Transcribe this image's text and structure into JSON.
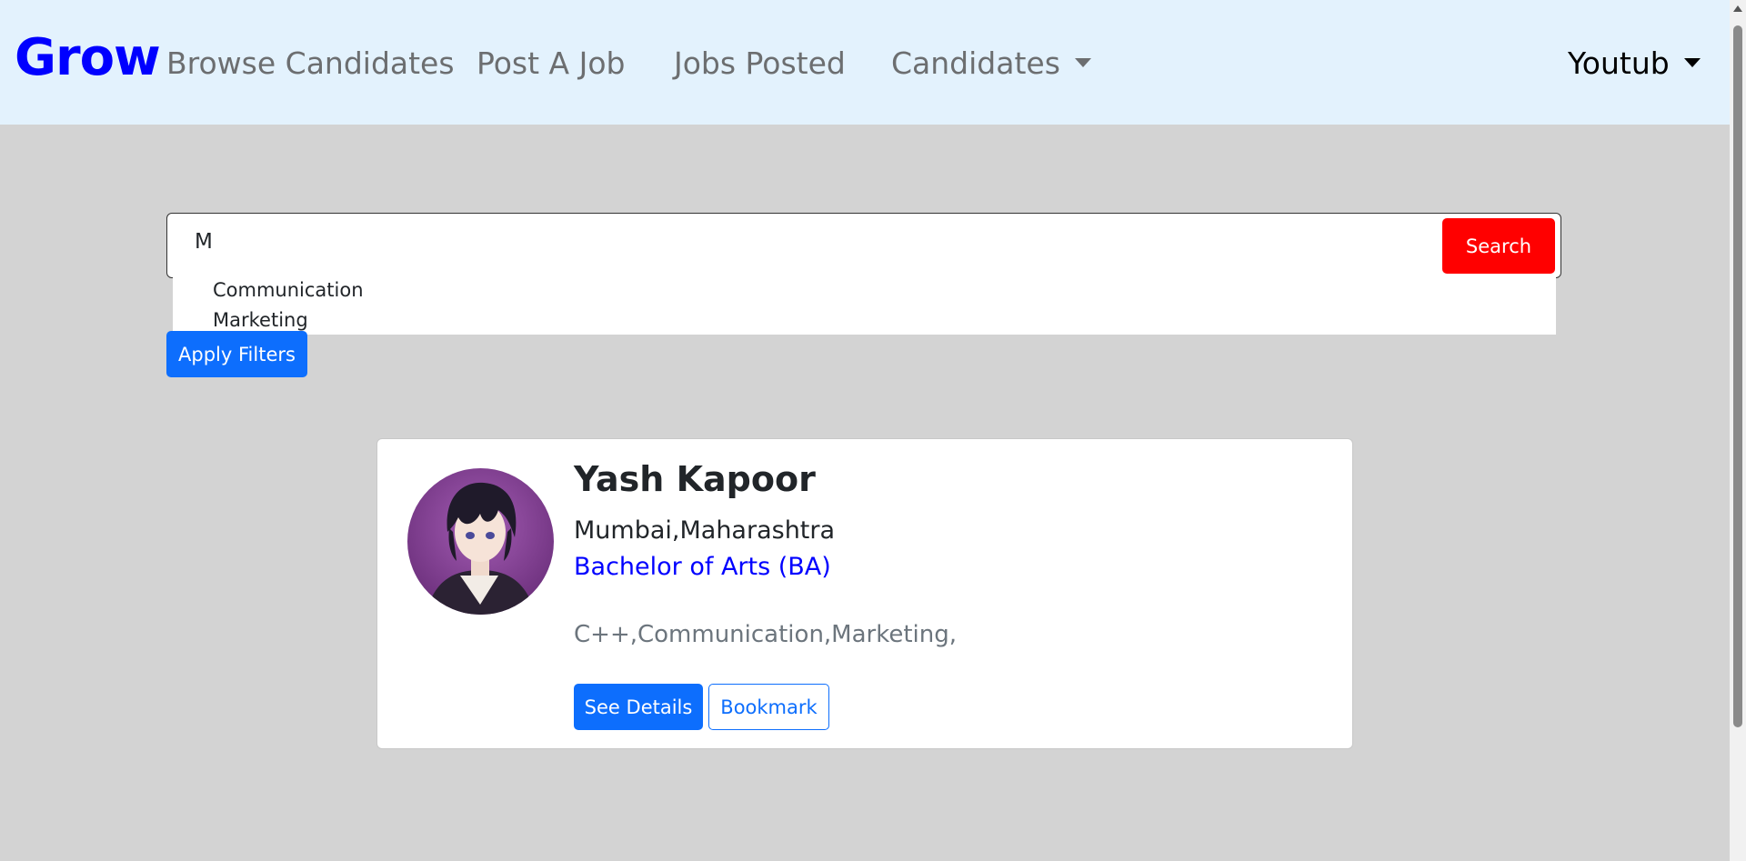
{
  "navbar": {
    "brand": "Grow",
    "links": [
      "Browse Candidates",
      "Post A Job",
      "Jobs Posted",
      "Candidates"
    ],
    "user": "Youtub"
  },
  "search": {
    "value": "M",
    "button": "Search",
    "suggestions": [
      "Communication",
      "Marketing"
    ],
    "apply_button": "Apply Filters"
  },
  "candidate": {
    "name": "Yash Kapoor",
    "location": "Mumbai,Maharashtra",
    "degree": "Bachelor of Arts (BA)",
    "skills": "C++,Communication,Marketing,",
    "details_button": "See Details",
    "bookmark_button": "Bookmark"
  },
  "colors": {
    "brand": "#0000ff",
    "navbar_bg": "#e3f2fd",
    "page_bg": "#d3d3d3",
    "search_button": "#ff0000",
    "primary": "#0d6efd"
  }
}
